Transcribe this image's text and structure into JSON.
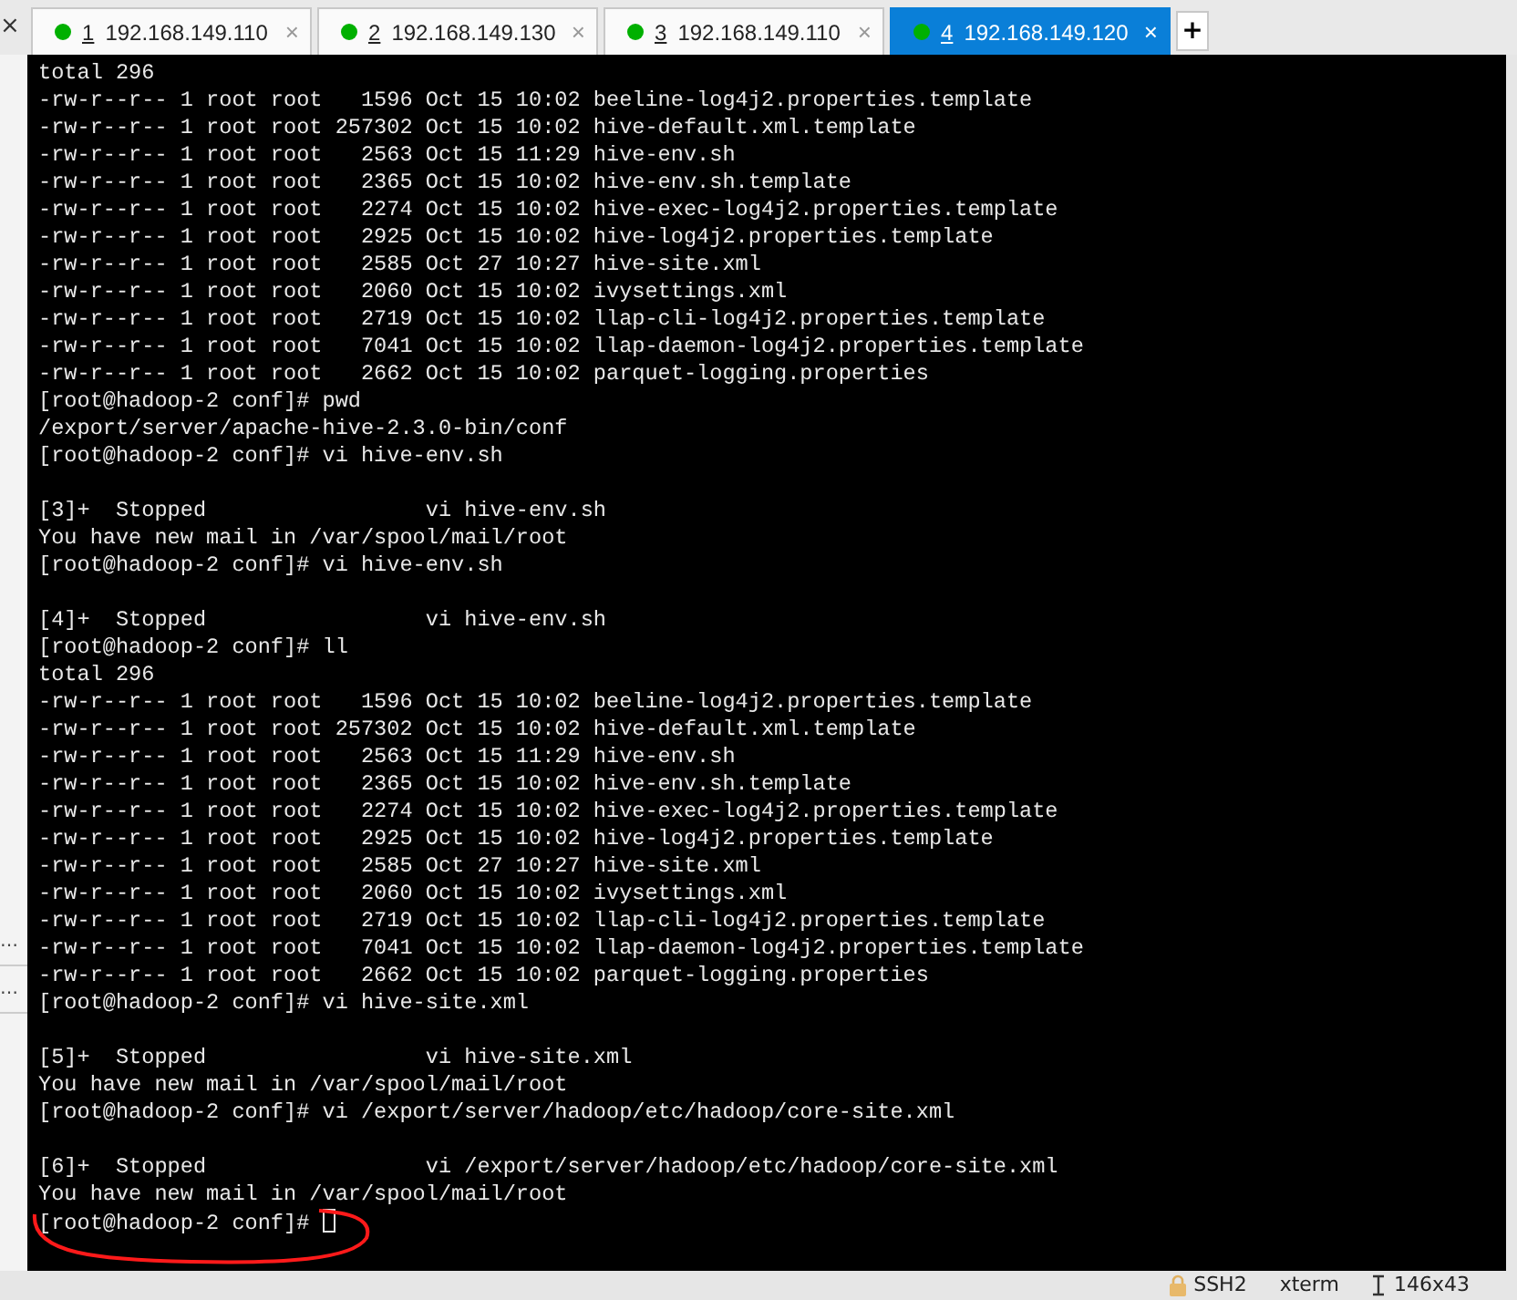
{
  "sidebar": {
    "close": "×",
    "items": [
      "…",
      "…"
    ]
  },
  "tabs": [
    {
      "number": "1",
      "host": "192.168.149.110",
      "close": "×",
      "selected": false,
      "color": "#00b000"
    },
    {
      "number": "2",
      "host": "192.168.149.130",
      "close": "×",
      "selected": false,
      "color": "#00b000"
    },
    {
      "number": "3",
      "host": "192.168.149.110",
      "close": "×",
      "selected": false,
      "color": "#00b000"
    },
    {
      "number": "4",
      "host": "192.168.149.120",
      "close": "×",
      "selected": true,
      "color": "#00b000"
    }
  ],
  "new_tab": "+",
  "terminal": {
    "lines": [
      {
        "text": "total 296"
      },
      {
        "text": "-rw-r--r-- 1 root root   1596 Oct 15 10:02 beeline-log4j2.properties.template"
      },
      {
        "text": "-rw-r--r-- 1 root root 257302 Oct 15 10:02 hive-default.xml.template"
      },
      {
        "text": "-rw-r--r-- 1 root root   2563 Oct 15 11:29 hive-env.sh"
      },
      {
        "text": "-rw-r--r-- 1 root root   2365 Oct 15 10:02 hive-env.sh.template"
      },
      {
        "text": "-rw-r--r-- 1 root root   2274 Oct 15 10:02 hive-exec-log4j2.properties.template"
      },
      {
        "text": "-rw-r--r-- 1 root root   2925 Oct 15 10:02 hive-log4j2.properties.template"
      },
      {
        "text": "-rw-r--r-- 1 root root   2585 Oct 27 10:27 hive-site.xml"
      },
      {
        "text": "-rw-r--r-- 1 root root   2060 Oct 15 10:02 ivysettings.xml"
      },
      {
        "text": "-rw-r--r-- 1 root root   2719 Oct 15 10:02 llap-cli-log4j2.properties.template"
      },
      {
        "text": "-rw-r--r-- 1 root root   7041 Oct 15 10:02 llap-daemon-log4j2.properties.template"
      },
      {
        "text": "-rw-r--r-- 1 root root   2662 Oct 15 10:02 parquet-logging.properties"
      },
      {
        "text": "[root@hadoop-2 conf]# pwd"
      },
      {
        "text": "/export/server/apache-hive-2.3.0-bin/conf"
      },
      {
        "text": "[root@hadoop-2 conf]# vi hive-env.sh"
      },
      {
        "text": "[3]+  Stopped                 vi hive-env.sh",
        "blank_before": true
      },
      {
        "text": "You have new mail in /var/spool/mail/root"
      },
      {
        "text": "[root@hadoop-2 conf]# vi hive-env.sh"
      },
      {
        "text": "[4]+  Stopped                 vi hive-env.sh",
        "blank_before": true
      },
      {
        "text": "[root@hadoop-2 conf]# ll"
      },
      {
        "text": "total 296"
      },
      {
        "text": "-rw-r--r-- 1 root root   1596 Oct 15 10:02 beeline-log4j2.properties.template"
      },
      {
        "text": "-rw-r--r-- 1 root root 257302 Oct 15 10:02 hive-default.xml.template"
      },
      {
        "text": "-rw-r--r-- 1 root root   2563 Oct 15 11:29 hive-env.sh"
      },
      {
        "text": "-rw-r--r-- 1 root root   2365 Oct 15 10:02 hive-env.sh.template"
      },
      {
        "text": "-rw-r--r-- 1 root root   2274 Oct 15 10:02 hive-exec-log4j2.properties.template"
      },
      {
        "text": "-rw-r--r-- 1 root root   2925 Oct 15 10:02 hive-log4j2.properties.template"
      },
      {
        "text": "-rw-r--r-- 1 root root   2585 Oct 27 10:27 hive-site.xml"
      },
      {
        "text": "-rw-r--r-- 1 root root   2060 Oct 15 10:02 ivysettings.xml"
      },
      {
        "text": "-rw-r--r-- 1 root root   2719 Oct 15 10:02 llap-cli-log4j2.properties.template"
      },
      {
        "text": "-rw-r--r-- 1 root root   7041 Oct 15 10:02 llap-daemon-log4j2.properties.template"
      },
      {
        "text": "-rw-r--r-- 1 root root   2662 Oct 15 10:02 parquet-logging.properties"
      },
      {
        "text": "[root@hadoop-2 conf]# vi hive-site.xml"
      },
      {
        "text": "[5]+  Stopped                 vi hive-site.xml",
        "blank_before": true
      },
      {
        "text": "You have new mail in /var/spool/mail/root"
      },
      {
        "text": "[root@hadoop-2 conf]# vi /export/server/hadoop/etc/hadoop/core-site.xml"
      },
      {
        "text": "[6]+  Stopped                 vi /export/server/hadoop/etc/hadoop/core-site.xml",
        "blank_before": true
      },
      {
        "text": "You have new mail in /var/spool/mail/root"
      },
      {
        "text": "[root@hadoop-2 conf]# ",
        "cursor": true
      }
    ]
  },
  "status_bar": {
    "protocol": "SSH2",
    "terminal_type": "xterm",
    "size": "146x43"
  }
}
